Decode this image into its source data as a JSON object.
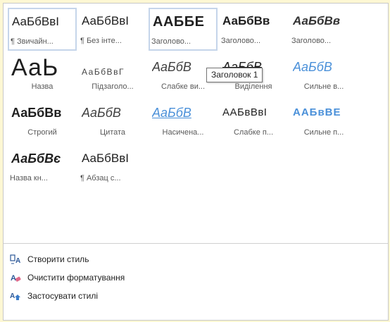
{
  "gallery": {
    "rows": [
      [
        {
          "sample": "АаБбВвІ",
          "label": "¶ Звичайн...",
          "selected": true
        },
        {
          "sample": "АаБбВвІ",
          "label": "¶ Без інте..."
        },
        {
          "sample": "ААББЕ",
          "label": "Заголово...",
          "hover": true
        },
        {
          "sample": "АаБбВв",
          "label": "Заголово..."
        },
        {
          "sample": "АаБбВв",
          "label": "Заголово..."
        }
      ],
      [
        {
          "sample": "АаЬ",
          "label": "Назва"
        },
        {
          "sample": "АаБбВвГ",
          "label": "Підзаголо..."
        },
        {
          "sample": "АаБбВ",
          "label": "Слабке ви..."
        },
        {
          "sample": "АаБбВ",
          "label": "Виділення"
        },
        {
          "sample": "АаБбВ",
          "label": "Сильне в..."
        }
      ],
      [
        {
          "sample": "АаБбВв",
          "label": "Строгий"
        },
        {
          "sample": "АаБбВ",
          "label": "Цитата"
        },
        {
          "sample": "АаБбВ",
          "label": "Насичена..."
        },
        {
          "sample": "ААБвВвІ",
          "label": "Слабке п..."
        },
        {
          "sample": "ААБвВЕ",
          "label": "Сильне п..."
        }
      ],
      [
        {
          "sample": "АаБбВє",
          "label": "Назва кн..."
        },
        {
          "sample": "АаБбВвІ",
          "label": "¶ Абзац с..."
        }
      ]
    ]
  },
  "tooltip": "Заголовок 1",
  "menu": {
    "create_style": "Створити стиль",
    "clear_formatting": "Очистити форматування",
    "apply_styles": "Застосувати стилі"
  },
  "colors": {
    "accent_blue": "#4a90d9",
    "selection_border": "#c5d5ea",
    "background": "#fdf7d3"
  },
  "icons": {
    "create_style": "create-style-icon",
    "clear_formatting": "clear-formatting-icon",
    "apply_styles": "apply-styles-icon"
  }
}
